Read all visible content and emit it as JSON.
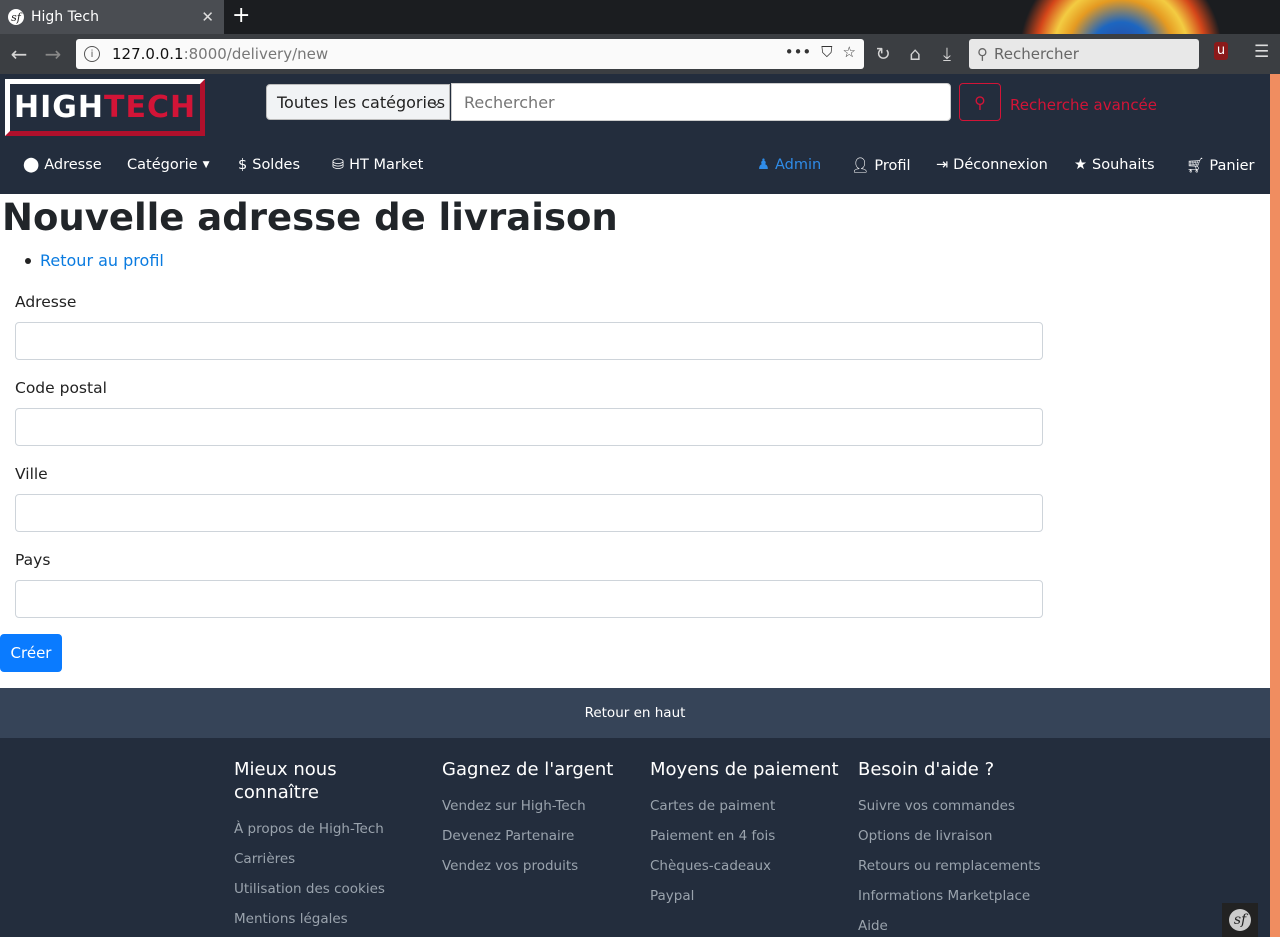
{
  "browser": {
    "tab_title": "High Tech",
    "new_tab": "+",
    "url_host": "127.0.0.1",
    "url_path": ":8000/delivery/new",
    "search_placeholder": "Rechercher"
  },
  "header": {
    "logo_left": "HIGH",
    "logo_right": "TECH",
    "category_select": "Toutes les catégories",
    "search_placeholder": "Rechercher",
    "advanced_search": "Recherche avancée"
  },
  "nav": {
    "left": [
      {
        "label": "Adresse",
        "icon": "map-marker-icon"
      },
      {
        "label": "Catégorie",
        "icon": "caret-down-icon"
      },
      {
        "label": "Soldes",
        "icon": "dollar-icon"
      },
      {
        "label": "HT Market",
        "icon": "coins-icon"
      }
    ],
    "right": [
      {
        "label": "Admin",
        "icon": "admin-icon"
      },
      {
        "label": "Profil",
        "icon": "user-icon"
      },
      {
        "label": "Déconnexion",
        "icon": "logout-icon"
      },
      {
        "label": "Souhaits",
        "icon": "star-icon"
      },
      {
        "label": "Panier",
        "icon": "cart-icon"
      }
    ]
  },
  "main": {
    "title": "Nouvelle adresse de livraison",
    "back_link": "Retour au profil",
    "fields": [
      {
        "label": "Adresse",
        "value": ""
      },
      {
        "label": "Code postal",
        "value": ""
      },
      {
        "label": "Ville",
        "value": ""
      },
      {
        "label": "Pays",
        "value": ""
      }
    ],
    "submit": "Créer"
  },
  "footer": {
    "back_to_top": "Retour en haut",
    "columns": [
      {
        "title": "Mieux nous connaître",
        "links": [
          "À propos de High-Tech",
          "Carrières",
          "Utilisation des cookies",
          "Mentions légales"
        ]
      },
      {
        "title": "Gagnez de l'argent",
        "links": [
          "Vendez sur High-Tech",
          "Devenez Partenaire",
          "Vendez vos produits"
        ]
      },
      {
        "title": "Moyens de paiement",
        "links": [
          "Cartes de paiment",
          "Paiement en 4 fois",
          "Chèques-cadeaux",
          "Paypal"
        ]
      },
      {
        "title": "Besoin d'aide ?",
        "links": [
          "Suivre vos commandes",
          "Options de livraison",
          "Retours ou remplacements",
          "Informations Marketplace",
          "Aide"
        ]
      }
    ]
  },
  "colors": {
    "header_bg": "#232d3d",
    "accent": "#d21437",
    "primary": "#0a7bff",
    "admin": "#2f8ce8"
  }
}
